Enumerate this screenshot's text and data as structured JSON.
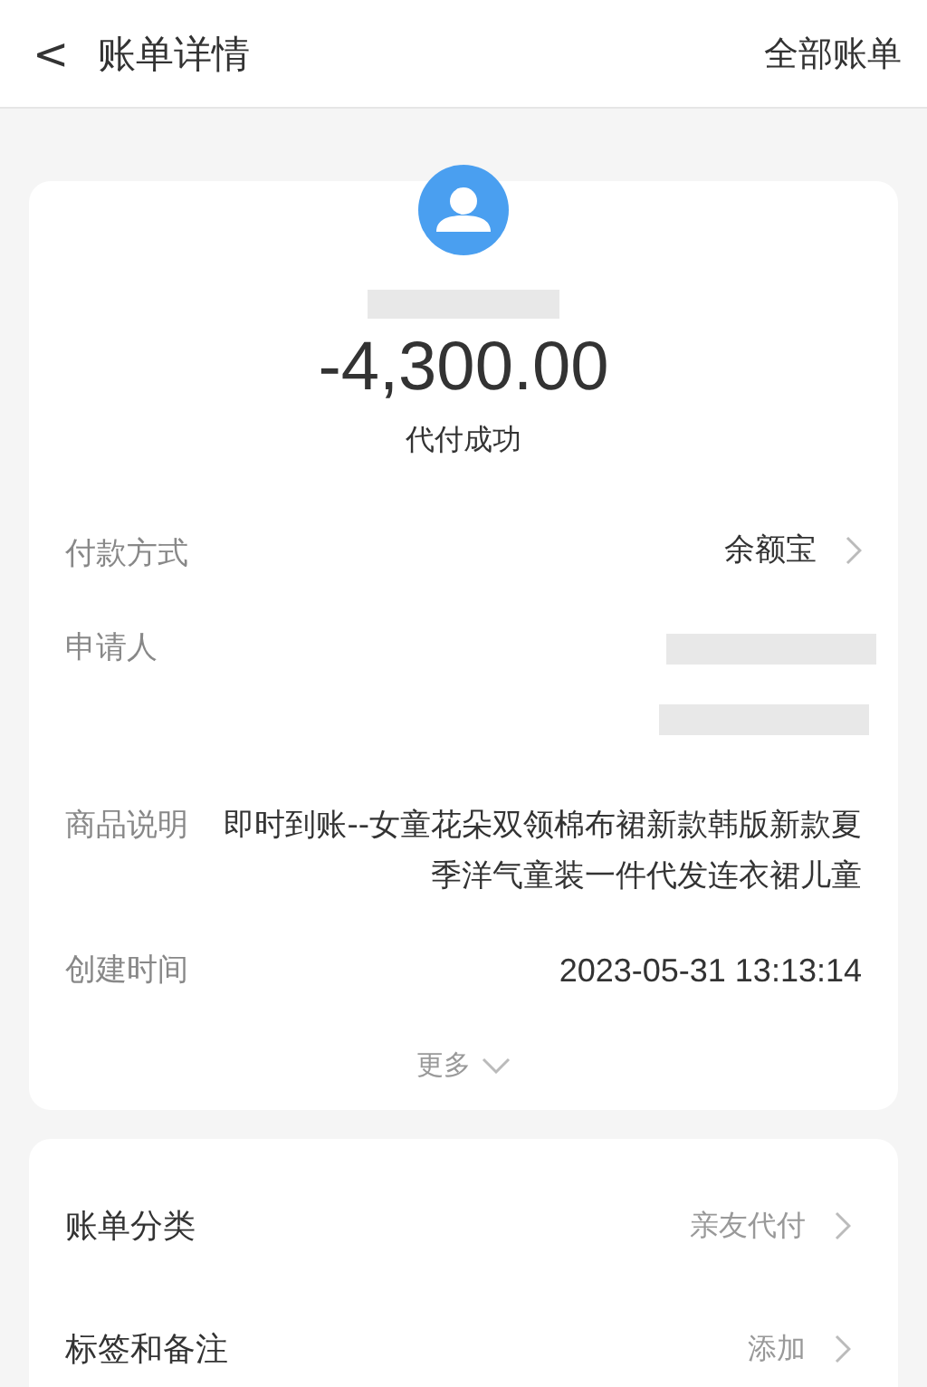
{
  "header": {
    "back_icon": "<",
    "title": "账单详情",
    "action": "全部账单"
  },
  "summary": {
    "amount": "-4,300.00",
    "status": "代付成功"
  },
  "details": [
    {
      "kind": "link",
      "label": "付款方式",
      "value": "余额宝"
    },
    {
      "kind": "redacted",
      "label": "申请人"
    },
    {
      "kind": "text",
      "label": "商品说明",
      "value": "即时到账--女童花朵双领棉布裙新款韩版新款夏季洋气童装一件代发连衣裙儿童"
    },
    {
      "kind": "text",
      "label": "创建时间",
      "value": "2023-05-31 13:13:14"
    }
  ],
  "more": "更多",
  "settings": [
    {
      "label": "账单分类",
      "value": "亲友代付"
    },
    {
      "label": "标签和备注",
      "value": "添加"
    }
  ]
}
